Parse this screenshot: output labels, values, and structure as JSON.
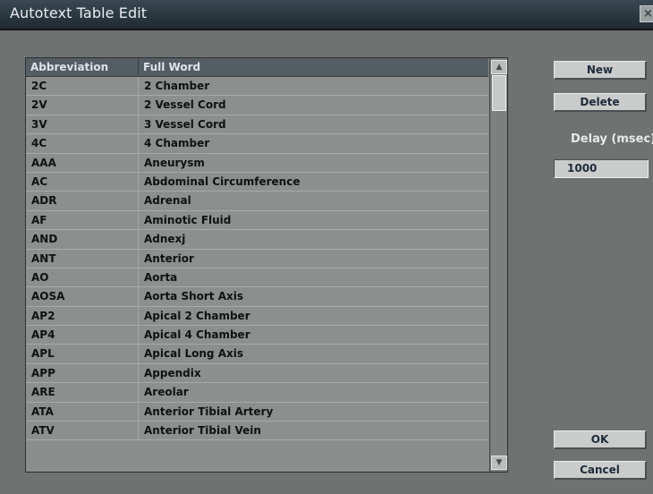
{
  "window": {
    "title": "Autotext Table Edit",
    "close_glyph": "×"
  },
  "table": {
    "columns": [
      "Abbreviation",
      "Full Word"
    ],
    "rows": [
      {
        "abbr": "2C",
        "full": "2 Chamber"
      },
      {
        "abbr": "2V",
        "full": "2 Vessel Cord"
      },
      {
        "abbr": "3V",
        "full": "3 Vessel Cord"
      },
      {
        "abbr": "4C",
        "full": "4 Chamber"
      },
      {
        "abbr": "AAA",
        "full": "Aneurysm"
      },
      {
        "abbr": "AC",
        "full": "Abdominal Circumference"
      },
      {
        "abbr": "ADR",
        "full": "Adrenal"
      },
      {
        "abbr": "AF",
        "full": "Aminotic Fluid"
      },
      {
        "abbr": "AND",
        "full": "Adnexj"
      },
      {
        "abbr": "ANT",
        "full": "Anterior"
      },
      {
        "abbr": "AO",
        "full": "Aorta"
      },
      {
        "abbr": "AOSA",
        "full": "Aorta Short Axis"
      },
      {
        "abbr": "AP2",
        "full": "Apical 2 Chamber"
      },
      {
        "abbr": "AP4",
        "full": "Apical 4 Chamber"
      },
      {
        "abbr": "APL",
        "full": "Apical Long Axis"
      },
      {
        "abbr": "APP",
        "full": "Appendix"
      },
      {
        "abbr": "ARE",
        "full": "Areolar"
      },
      {
        "abbr": "ATA",
        "full": "Anterior Tibial Artery"
      },
      {
        "abbr": "ATV",
        "full": "Anterior Tibial Vein"
      }
    ]
  },
  "buttons": {
    "new": "New",
    "delete": "Delete",
    "ok": "OK",
    "cancel": "Cancel"
  },
  "delay": {
    "label": "Delay (msec)",
    "value": "1000"
  },
  "colors": {
    "background": "#6e7271",
    "header": "#545d62",
    "row": "#8b8f8e",
    "button": "#c9cccb"
  }
}
